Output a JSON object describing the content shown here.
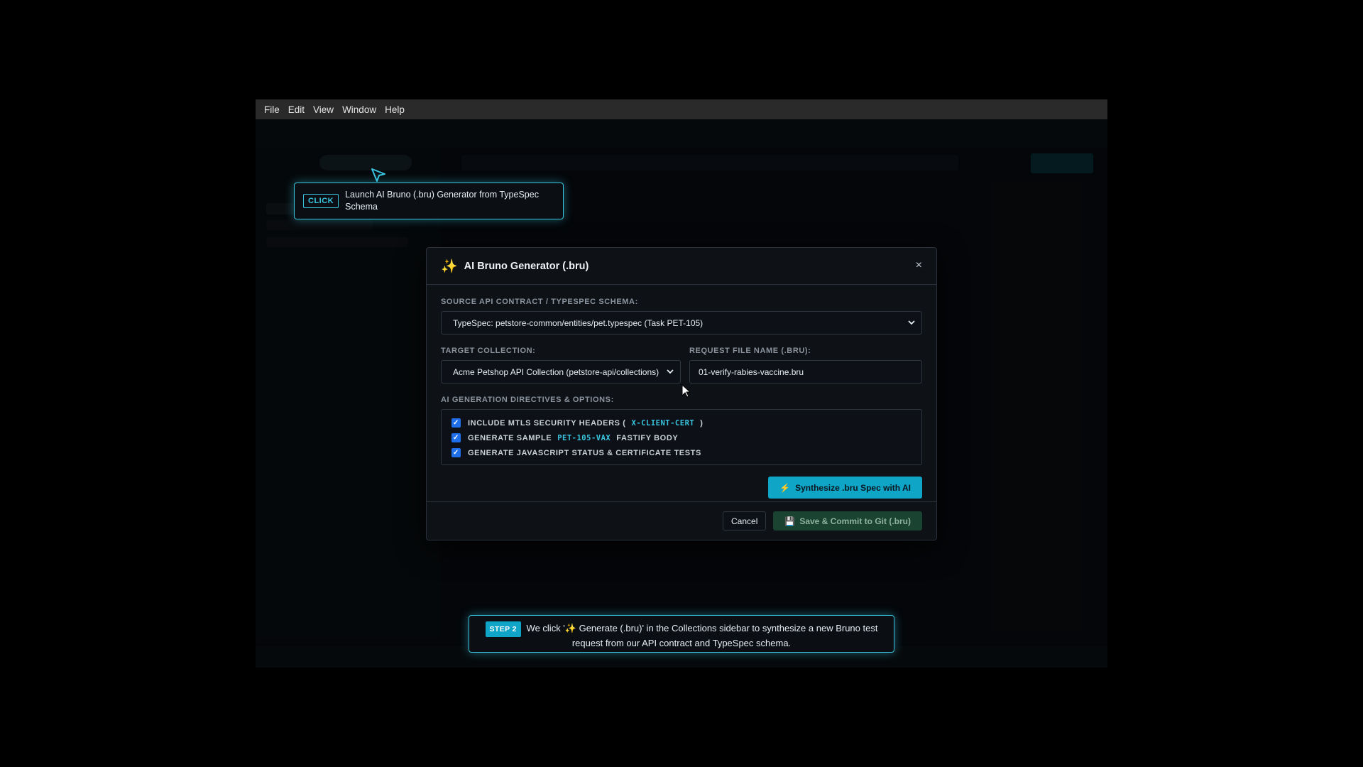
{
  "menubar": {
    "items": [
      "File",
      "Edit",
      "View",
      "Window",
      "Help"
    ]
  },
  "click_callout": {
    "badge": "CLICK",
    "text": "Launch AI Bruno (.bru) Generator from TypeSpec Schema"
  },
  "modal": {
    "icon": "sparkles-icon",
    "title": "AI Bruno Generator (.bru)",
    "close_label": "×",
    "source_label": "SOURCE API CONTRACT / TYPESPEC SCHEMA:",
    "source_value": "TypeSpec: petstore-common/entities/pet.typespec (Task PET-105)",
    "target_label": "TARGET COLLECTION:",
    "target_value": "Acme Petshop API Collection (petstore-api/collections)",
    "filename_label": "REQUEST FILE NAME (.BRU):",
    "filename_value": "01-verify-rabies-vaccine.bru",
    "directives_label": "AI GENERATION DIRECTIVES & OPTIONS:",
    "options": [
      {
        "pre": "INCLUDE MTLS SECURITY HEADERS (",
        "code": "X-CLIENT-CERT",
        "post": ")",
        "checked": true
      },
      {
        "pre": "GENERATE SAMPLE",
        "code": "PET-105-VAX",
        "post": "FASTIFY BODY",
        "checked": true
      },
      {
        "pre": "GENERATE JAVASCRIPT STATUS & CERTIFICATE TESTS",
        "code": "",
        "post": "",
        "checked": true
      }
    ],
    "synthesize_label": "Synthesize .bru Spec with AI",
    "cancel_label": "Cancel",
    "save_label": "Save & Commit to Git (.bru)"
  },
  "step_callout": {
    "badge": "STEP 2",
    "text": "We click '✨ Generate (.bru)' in the Collections sidebar to synthesize a new Bruno test request from our API contract and TypeSpec schema."
  },
  "colors": {
    "accent": "#39c5e0",
    "primary_button": "#0ea5c6",
    "save_button": "#1b4332",
    "checkbox": "#1f6feb"
  }
}
